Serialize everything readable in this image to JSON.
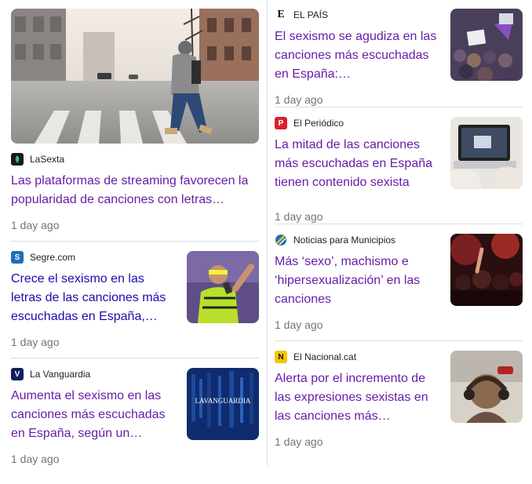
{
  "articles": [
    {
      "source": "LaSexta",
      "headline": "Las plataformas de streaming favorecen la popularidad de canciones con letras…",
      "time": "1 day ago",
      "logo_icon": "lasexta-logo-icon",
      "logo_color": "#1a1a1a"
    },
    {
      "source": "EL PAÍS",
      "headline": "El sexismo se agudiza en las canciones más escuchadas en España:…",
      "time": "1 day ago",
      "logo_icon": "elpais-logo-icon",
      "logo_color": "#ffffff"
    },
    {
      "source": "El Periódico",
      "headline": "La mitad de las canciones más escuchadas en España tienen contenido sexista",
      "time": "1 day ago",
      "logo_icon": "elperiodico-logo-icon",
      "logo_color": "#d9212b"
    },
    {
      "source": "Segre.com",
      "headline": "Crece el sexismo en las letras de las canciones más escuchadas en España,…",
      "time": "1 day ago",
      "logo_icon": "segre-logo-icon",
      "logo_color": "#1d6fb8"
    },
    {
      "source": "Noticias para Municipios",
      "headline": "Más ‘sexo’, machismo e ‘hipersexualización’ en las canciones",
      "time": "1 day ago",
      "logo_icon": "noticias-municipios-logo-icon",
      "logo_color": "#2a6cc0"
    },
    {
      "source": "La Vanguardia",
      "headline": "Aumenta el sexismo en las canciones más escuchadas en España, según un…",
      "time": "1 day ago",
      "logo_icon": "lavanguardia-logo-icon",
      "logo_color": "#10205e",
      "thumb_text": "LAVANGUARDIA"
    },
    {
      "source": "El Nacional.cat",
      "headline": "Alerta por el incremento de las expresiones sexistas en las canciones más…",
      "time": "1 day ago",
      "logo_icon": "elnacional-logo-icon",
      "logo_color": "#f5c400"
    }
  ]
}
